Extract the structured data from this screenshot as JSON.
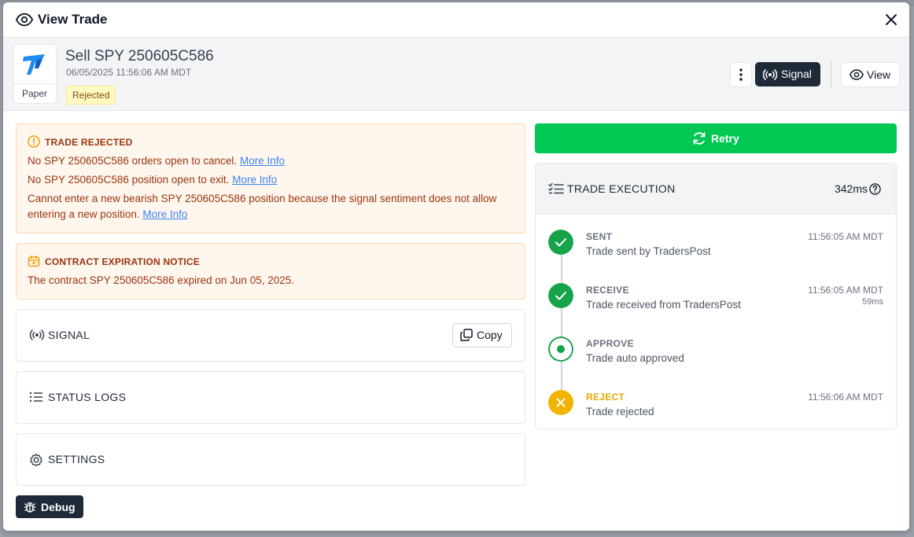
{
  "modal": {
    "title": "View Trade",
    "eye_icon": "eye-icon",
    "close_icon": "close-icon"
  },
  "header": {
    "broker_label": "Paper",
    "trade_title": "Sell SPY 250605C586",
    "timestamp": "06/05/2025 11:56:06 AM MDT",
    "status_badge": "Rejected",
    "signal_button": "Signal",
    "view_button": "View"
  },
  "alerts": {
    "rejected": {
      "heading": "TRADE REJECTED",
      "line1_text": "No SPY 250605C586 orders open to cancel.",
      "line2_text": "No SPY 250605C586 position open to exit.",
      "line3_text": "Cannot enter a new bearish SPY 250605C586 position because the signal sentiment does not allow entering a new position.",
      "more_info": "More Info"
    },
    "expiry": {
      "heading": "CONTRACT EXPIRATION NOTICE",
      "line": "The contract SPY 250605C586 expired on Jun 05, 2025."
    }
  },
  "sections": {
    "signal": "SIGNAL",
    "copy_button": "Copy",
    "status_logs": "STATUS LOGS",
    "settings": "SETTINGS"
  },
  "debug_button": "Debug",
  "retry_button": "Retry",
  "execution": {
    "title": "TRADE EXECUTION",
    "total_ms": "342ms",
    "steps": [
      {
        "name": "SENT",
        "desc": "Trade sent by TradersPost",
        "time": "11:56:05 AM MDT",
        "duration": "",
        "state": "done"
      },
      {
        "name": "RECEIVE",
        "desc": "Trade received from TradersPost",
        "time": "11:56:05 AM MDT",
        "duration": "59ms",
        "state": "done"
      },
      {
        "name": "APPROVE",
        "desc": "Trade auto approved",
        "time": "",
        "duration": "",
        "state": "current"
      },
      {
        "name": "REJECT",
        "desc": "Trade rejected",
        "time": "11:56:06 AM MDT",
        "duration": "",
        "state": "rejected"
      }
    ]
  },
  "colors": {
    "success": "#16a34a",
    "retry": "#00c853",
    "reject": "#f0b400",
    "dark_button": "#1f2937",
    "alert_text": "#9a3412",
    "link": "#3b82f6"
  }
}
